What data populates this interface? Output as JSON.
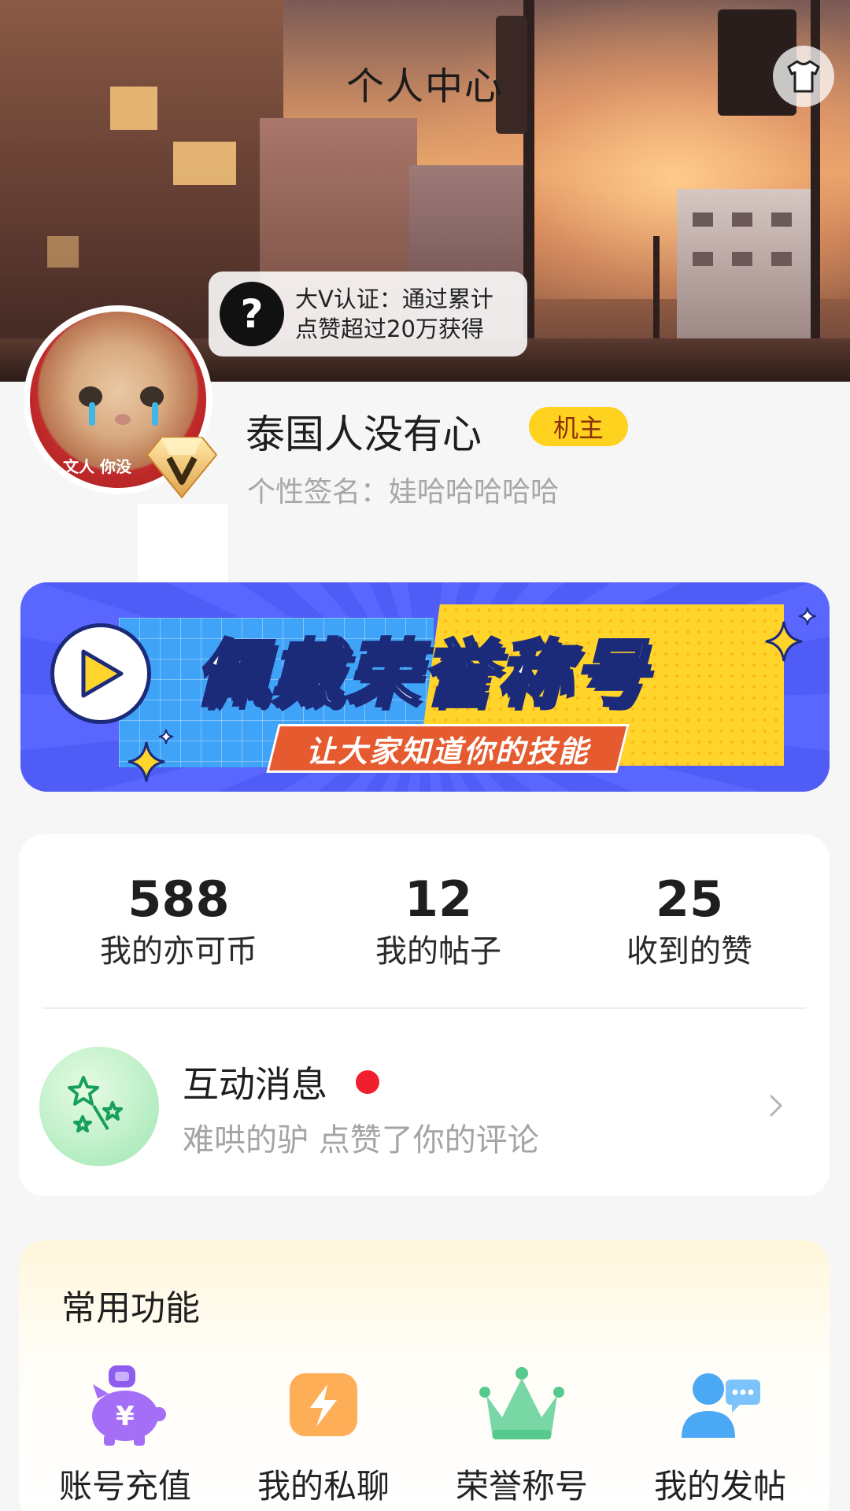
{
  "header": {
    "title": "个人中心",
    "skin_icon": "tshirt-icon"
  },
  "tip": {
    "icon": "question-icon",
    "text_line1": "大V认证：通过累计",
    "text_line2": "点赞超过20万获得"
  },
  "profile": {
    "avatar_caption": "文人 你没",
    "badge_icon": "v-badge-icon",
    "nickname": "泰国人没有心",
    "role": "机主",
    "signature": "个性签名：娃哈哈哈哈哈"
  },
  "banner": {
    "title": "佩戴荣誉称号",
    "subtitle": "让大家知道你的技能"
  },
  "stats": [
    {
      "value": "588",
      "label": "我的亦可币"
    },
    {
      "value": "12",
      "label": "我的帖子"
    },
    {
      "value": "25",
      "label": "收到的赞"
    }
  ],
  "message": {
    "title": "互动消息",
    "subtitle": "难哄的驴 点赞了你的评论",
    "unread": true
  },
  "features": {
    "title": "常用功能",
    "items": [
      {
        "label": "账号充值",
        "icon": "piggy-bank-icon"
      },
      {
        "label": "我的私聊",
        "icon": "lightning-chat-icon"
      },
      {
        "label": "荣誉称号",
        "icon": "crown-icon"
      },
      {
        "label": "我的发帖",
        "icon": "user-message-icon"
      }
    ]
  },
  "colors": {
    "badge_yellow": "#ffd21f",
    "banner_blue": "#4f5cf5",
    "unread_red": "#ef1f2e",
    "background": "#f6f6f7"
  }
}
